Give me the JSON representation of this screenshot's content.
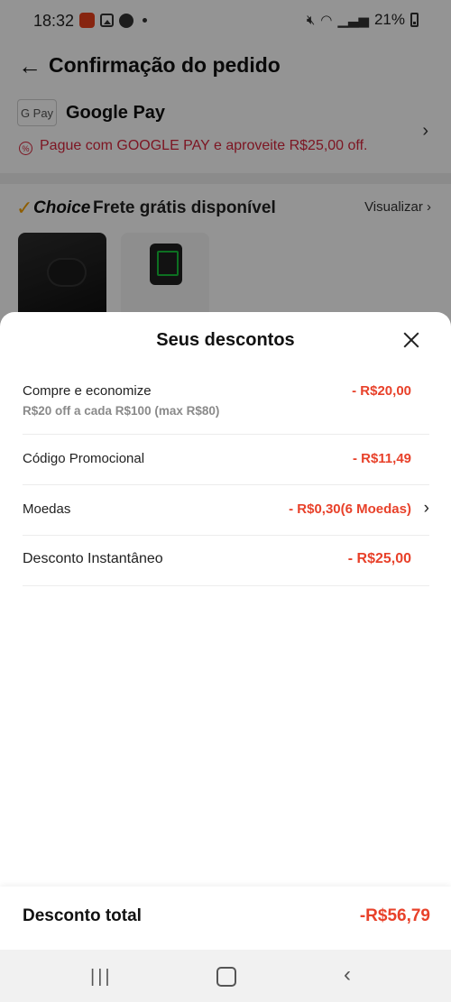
{
  "status": {
    "time": "18:32",
    "battery": "21%"
  },
  "header": {
    "title": "Confirmação do pedido"
  },
  "payment": {
    "badge": "G Pay",
    "title": "Google Pay",
    "promo": "Pague com GOOGLE PAY e aproveite R$25,00 off."
  },
  "shipping": {
    "brand": "Choice",
    "text": "Frete grátis disponível",
    "view_label": "Visualizar"
  },
  "sheet": {
    "title": "Seus descontos",
    "rows": [
      {
        "label": "Compre e economize",
        "sub": "R$20 off a cada R$100 (max R$80)",
        "value": "- R$20,00"
      },
      {
        "label": "Código Promocional",
        "value": "- R$11,49"
      },
      {
        "label": "Moedas",
        "value": "- R$0,30(6 Moedas)"
      },
      {
        "label": "Desconto Instantâneo",
        "value": "- R$25,00"
      }
    ],
    "total_label": "Desconto total",
    "total_value": "-R$56,79"
  },
  "colors": {
    "accent": "#e8412a",
    "promo": "#d7263d",
    "choice_check": "#f5a000"
  },
  "icons": [
    "back-arrow-icon",
    "chevron-right-icon",
    "close-icon",
    "promo-percent-icon"
  ]
}
